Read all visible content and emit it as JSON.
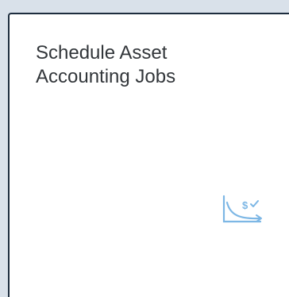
{
  "tile": {
    "title_line1": "Schedule Asset",
    "title_line2": "Accounting Jobs",
    "icon": "depreciation-chart-icon",
    "icon_symbol": "$",
    "colors": {
      "title": "#32363a",
      "icon": "#7db7e5",
      "border": "#1d2d3e",
      "background": "#ffffff",
      "page_background": "#d9e1ea"
    }
  }
}
